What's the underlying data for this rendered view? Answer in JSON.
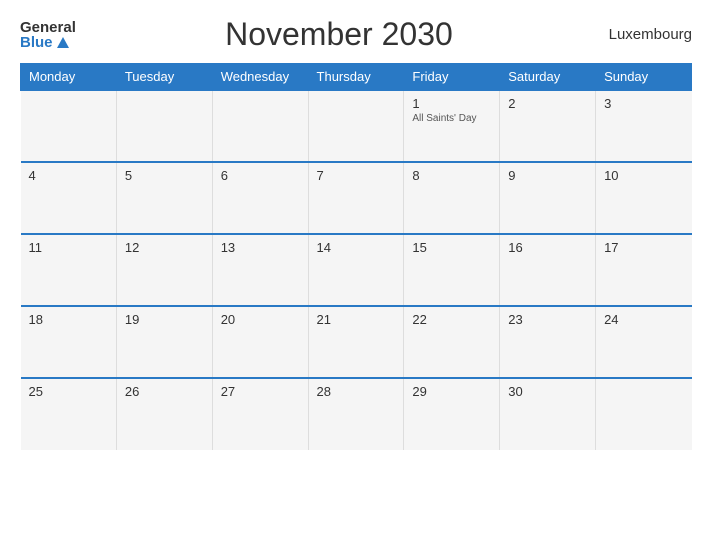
{
  "header": {
    "logo_general": "General",
    "logo_blue": "Blue",
    "title": "November 2030",
    "country": "Luxembourg"
  },
  "days_of_week": [
    "Monday",
    "Tuesday",
    "Wednesday",
    "Thursday",
    "Friday",
    "Saturday",
    "Sunday"
  ],
  "weeks": [
    [
      {
        "day": "",
        "holiday": ""
      },
      {
        "day": "",
        "holiday": ""
      },
      {
        "day": "",
        "holiday": ""
      },
      {
        "day": "",
        "holiday": ""
      },
      {
        "day": "1",
        "holiday": "All Saints' Day"
      },
      {
        "day": "2",
        "holiday": ""
      },
      {
        "day": "3",
        "holiday": ""
      }
    ],
    [
      {
        "day": "4",
        "holiday": ""
      },
      {
        "day": "5",
        "holiday": ""
      },
      {
        "day": "6",
        "holiday": ""
      },
      {
        "day": "7",
        "holiday": ""
      },
      {
        "day": "8",
        "holiday": ""
      },
      {
        "day": "9",
        "holiday": ""
      },
      {
        "day": "10",
        "holiday": ""
      }
    ],
    [
      {
        "day": "11",
        "holiday": ""
      },
      {
        "day": "12",
        "holiday": ""
      },
      {
        "day": "13",
        "holiday": ""
      },
      {
        "day": "14",
        "holiday": ""
      },
      {
        "day": "15",
        "holiday": ""
      },
      {
        "day": "16",
        "holiday": ""
      },
      {
        "day": "17",
        "holiday": ""
      }
    ],
    [
      {
        "day": "18",
        "holiday": ""
      },
      {
        "day": "19",
        "holiday": ""
      },
      {
        "day": "20",
        "holiday": ""
      },
      {
        "day": "21",
        "holiday": ""
      },
      {
        "day": "22",
        "holiday": ""
      },
      {
        "day": "23",
        "holiday": ""
      },
      {
        "day": "24",
        "holiday": ""
      }
    ],
    [
      {
        "day": "25",
        "holiday": ""
      },
      {
        "day": "26",
        "holiday": ""
      },
      {
        "day": "27",
        "holiday": ""
      },
      {
        "day": "28",
        "holiday": ""
      },
      {
        "day": "29",
        "holiday": ""
      },
      {
        "day": "30",
        "holiday": ""
      },
      {
        "day": "",
        "holiday": ""
      }
    ]
  ]
}
